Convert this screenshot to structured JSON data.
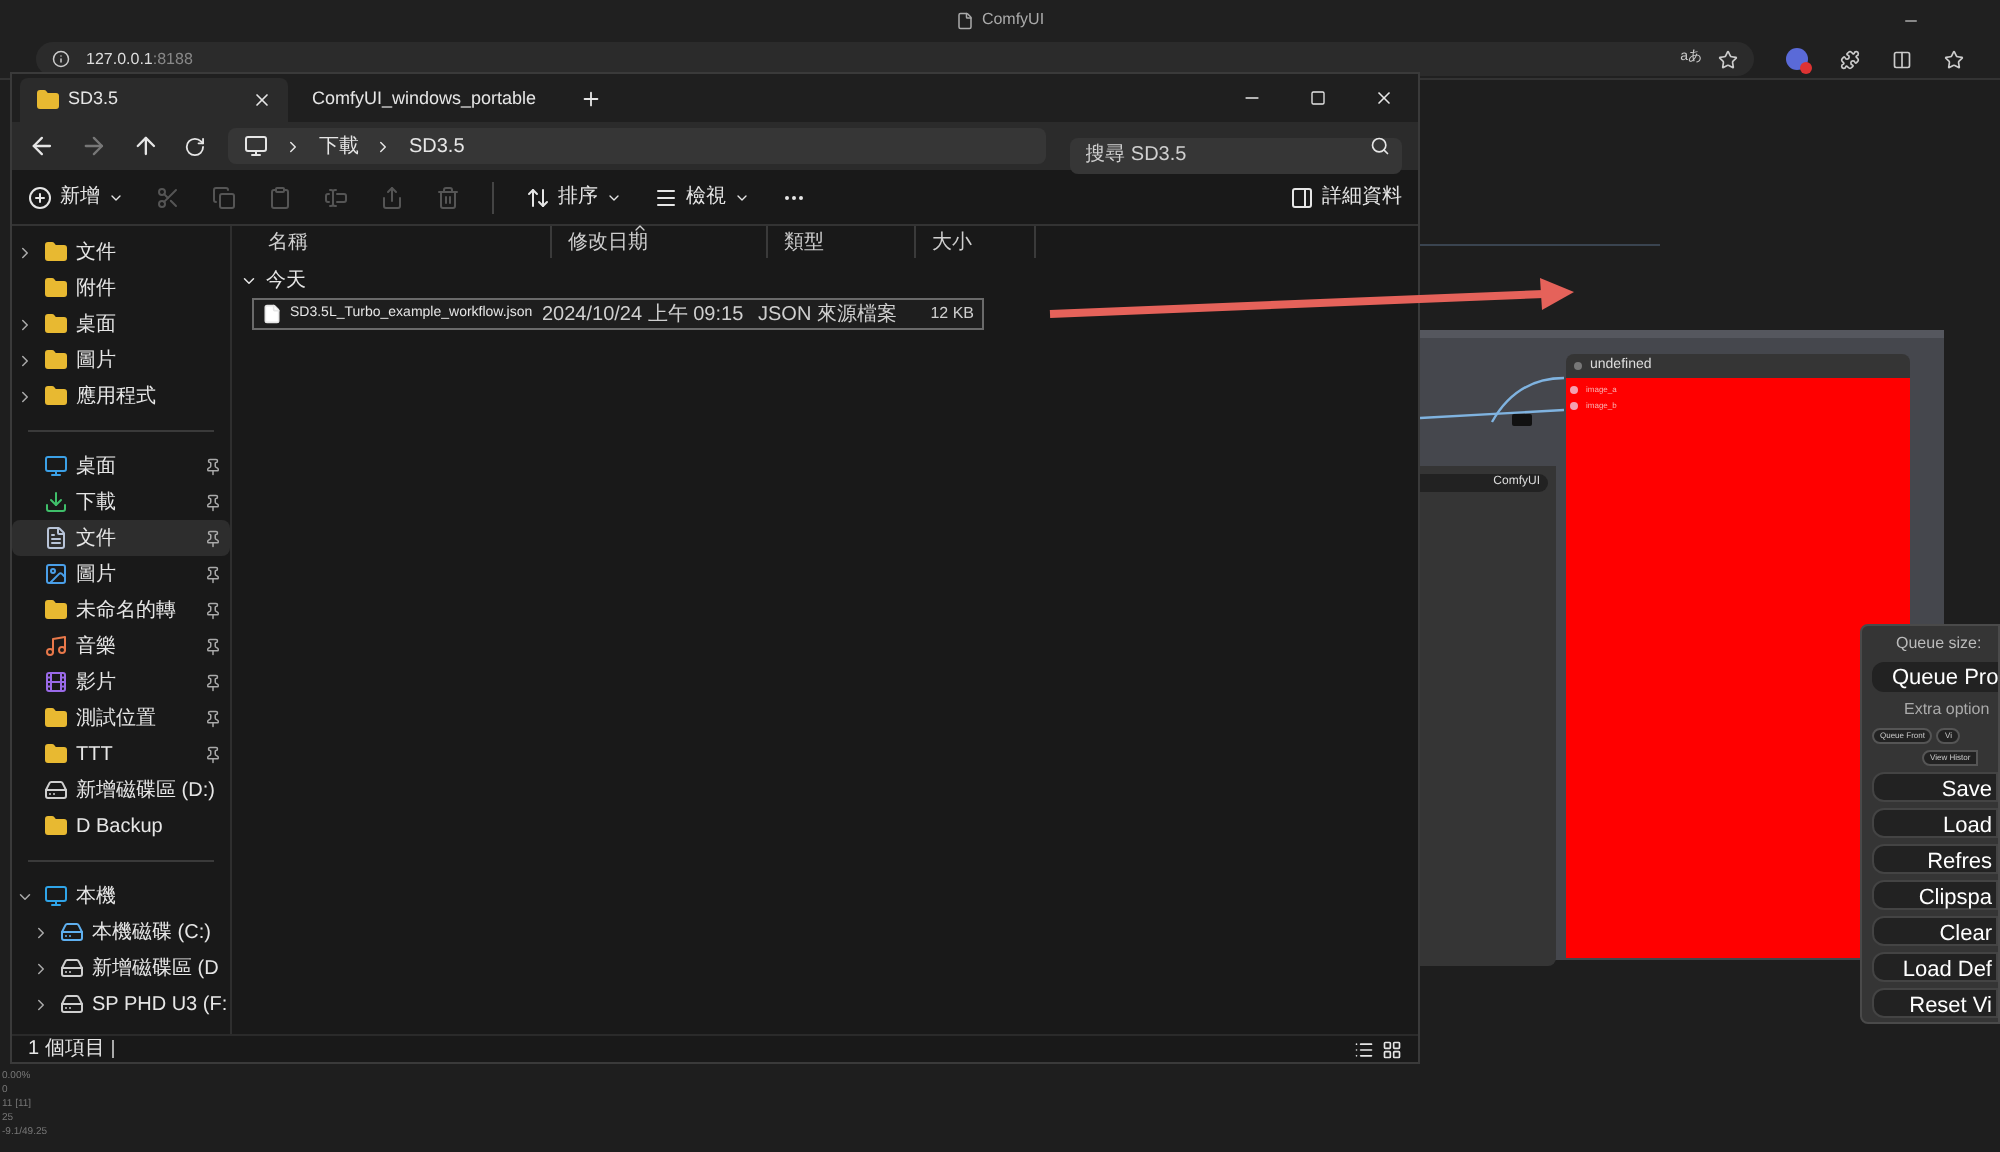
{
  "browser": {
    "title": "ComfyUI",
    "url_host": "127.0.0.1",
    "url_port": ":8188",
    "read_aloud": "aあ"
  },
  "explorer": {
    "tabs": [
      {
        "label": "SD3.5",
        "selected": true
      },
      {
        "label": "ComfyUI_windows_portable",
        "selected": false
      }
    ],
    "breadcrumb": [
      "下載",
      "SD3.5"
    ],
    "search": {
      "placeholder": "搜尋 SD3.5"
    },
    "toolbar": {
      "new": "新增",
      "sort": "排序",
      "view": "檢視",
      "details": "詳細資料"
    },
    "sidebar": [
      {
        "label": "文件",
        "kind": "folder",
        "expanded": false,
        "pinned": false,
        "selected": false
      },
      {
        "label": "附件",
        "kind": "folder",
        "pinned": false,
        "selected": false
      },
      {
        "label": "桌面",
        "kind": "folder",
        "expanded": false,
        "pinned": false,
        "selected": false
      },
      {
        "label": "圖片",
        "kind": "folder",
        "expanded": false,
        "pinned": false,
        "selected": false
      },
      {
        "label": "應用程式",
        "kind": "folder",
        "expanded": false,
        "pinned": false,
        "selected": false
      },
      {
        "kind": "divider"
      },
      {
        "label": "桌面",
        "kind": "desktop",
        "pinned": true,
        "selected": false
      },
      {
        "label": "下載",
        "kind": "download",
        "pinned": true,
        "selected": false
      },
      {
        "label": "文件",
        "kind": "document",
        "pinned": true,
        "selected": true
      },
      {
        "label": "圖片",
        "kind": "picture",
        "pinned": true,
        "selected": false
      },
      {
        "label": "未命名的轉",
        "kind": "folder",
        "pinned": true,
        "selected": false
      },
      {
        "label": "音樂",
        "kind": "music",
        "pinned": true,
        "selected": false
      },
      {
        "label": "影片",
        "kind": "video",
        "pinned": true,
        "selected": false
      },
      {
        "label": "測試位置",
        "kind": "folder",
        "pinned": true,
        "selected": false
      },
      {
        "label": "TTT",
        "kind": "folder",
        "pinned": true,
        "selected": false
      },
      {
        "label": "新增磁碟區 (D:)",
        "kind": "drive",
        "pinned": false,
        "selected": false
      },
      {
        "label": "D Backup",
        "kind": "folder",
        "pinned": false,
        "selected": false
      },
      {
        "kind": "divider"
      },
      {
        "label": "本機",
        "kind": "computer",
        "expanded": true,
        "pinned": false,
        "selected": false,
        "children": [
          {
            "label": "本機磁碟 (C:)",
            "kind": "system-drive",
            "expanded": false,
            "pinned": false,
            "selected": false
          },
          {
            "label": "新增磁碟區 (D",
            "kind": "drive",
            "expanded": false,
            "pinned": false,
            "selected": false
          },
          {
            "label": "SP PHD U3 (F:",
            "kind": "drive",
            "expanded": false,
            "pinned": false,
            "selected": false
          }
        ]
      }
    ],
    "columns": [
      {
        "label": "名稱",
        "sorted": false
      },
      {
        "label": "修改日期",
        "sorted": true
      },
      {
        "label": "類型",
        "sorted": false
      },
      {
        "label": "大小",
        "sorted": false
      }
    ],
    "group": {
      "label": "今天",
      "expanded": true
    },
    "rows": [
      {
        "name": "SD3.5L_Turbo_example_workflow.json",
        "date": "2024/10/24 上午 09:15",
        "type": "JSON 來源檔案",
        "size": "12 KB",
        "selected": true
      }
    ],
    "status": "1 個項目"
  },
  "comfy": {
    "left_node": {
      "field": "ComfyUI"
    },
    "node": {
      "title": "undefined",
      "inputs": [
        "image_a",
        "image_b"
      ]
    },
    "queue_panel": {
      "queue_size": "Queue size:",
      "queue_button": "Queue Pro",
      "extra_options": "Extra option",
      "small_buttons": [
        "Queue Front",
        "Vi"
      ],
      "history": "View Histor",
      "buttons": [
        "Save",
        "Load",
        "Refres",
        "Clipspa",
        "Clear",
        "Load Def",
        "Reset Vi"
      ]
    },
    "stats": [
      "0.00%",
      "0",
      "11 [11]",
      "25",
      "-9.1/49.25"
    ]
  }
}
